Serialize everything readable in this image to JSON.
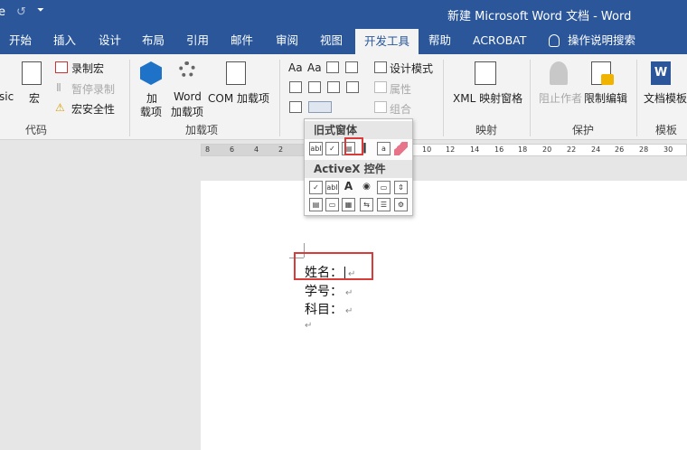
{
  "titlebar": {
    "quick_access": [
      "e",
      "↺",
      "⏷"
    ],
    "title": "新建 Microsoft Word 文档  -  Word"
  },
  "tabs": [
    {
      "label": "开始",
      "active": false
    },
    {
      "label": "插入",
      "active": false
    },
    {
      "label": "设计",
      "active": false
    },
    {
      "label": "布局",
      "active": false
    },
    {
      "label": "引用",
      "active": false
    },
    {
      "label": "邮件",
      "active": false
    },
    {
      "label": "审阅",
      "active": false
    },
    {
      "label": "视图",
      "active": false
    },
    {
      "label": "开发工具",
      "active": true
    },
    {
      "label": "帮助",
      "active": false
    },
    {
      "label": "ACROBAT",
      "active": false
    },
    {
      "label": "操作说明搜索",
      "active": false
    }
  ],
  "ribbon": {
    "code": {
      "visual_basic": "sic",
      "macros": "宏",
      "record_macro": "录制宏",
      "pause_recording": "暂停录制",
      "macro_security": "宏安全性",
      "group_label": "代码"
    },
    "addins": {
      "addins_label_1": "加",
      "addins_label_2": "载项",
      "word_addins_1": "Word",
      "word_addins_2": "加载项",
      "com_addins": "COM 加载项",
      "group_label": "加载项"
    },
    "controls": {
      "text_aa": "Aa",
      "design_mode": "设计模式",
      "properties": "属性",
      "group": "组合"
    },
    "mapping": {
      "xml_pane": "XML 映射窗格",
      "group_label": "映射"
    },
    "protect": {
      "block_authors": "阻止作者",
      "restrict_editing": "限制编辑",
      "group_label": "保护"
    },
    "templates": {
      "doc_template": "文档模板",
      "group_label": "模板"
    }
  },
  "ruler_numbers": [
    "8",
    "6",
    "4",
    "2",
    "10",
    "12",
    "14",
    "16",
    "18",
    "20",
    "22",
    "24",
    "26",
    "28",
    "30"
  ],
  "dropdown": {
    "legacy_header": "旧式窗体",
    "legacy_items": [
      "abl",
      "✓",
      "▤",
      "ǀ",
      "a",
      ""
    ],
    "activex_header": "ActiveX 控件",
    "activex_row1": [
      "✓",
      "abl",
      "A",
      "◉",
      "▭",
      "⇕"
    ],
    "activex_row2": [
      "▤",
      "▭",
      "▦",
      "⇆",
      "☰",
      "⚙"
    ]
  },
  "document": {
    "lines": [
      {
        "text": "姓名：",
        "mark": "↵",
        "has_caret": true
      },
      {
        "text": "学号：",
        "mark": "↵",
        "has_caret": false
      },
      {
        "text": "科目：",
        "mark": "↵",
        "has_caret": false
      },
      {
        "text": "",
        "mark": "↵",
        "has_caret": false
      }
    ]
  },
  "colors": {
    "accent": "#2b579a",
    "highlight": "#d93a3a",
    "ribbon_bg": "#f3f3f3"
  }
}
